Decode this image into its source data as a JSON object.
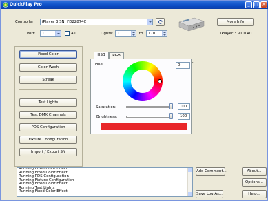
{
  "window": {
    "title": "QuickPlay Pro",
    "controls": {
      "minimize": "_",
      "maximize": "□",
      "close": "×"
    }
  },
  "header": {
    "controller_label": "Controller:",
    "controller_value": "iPlayer 3 SN: FD22874C",
    "port_label": "Port:",
    "port_value": "1",
    "all_label": "All",
    "all_checked": false,
    "lights_label": "Lights:",
    "lights_from": "1",
    "lights_to_label": "to",
    "lights_to": "170",
    "more_info_label": "More Info",
    "device_version": "iPlayer 3 v1.0.40"
  },
  "sidebar": {
    "items": [
      {
        "label": "Fixed Color",
        "active": true
      },
      {
        "label": "Color Wash",
        "active": false
      },
      {
        "label": "Streak",
        "active": false
      },
      {
        "label": "Test Lights",
        "active": false
      },
      {
        "label": "Test DMX Channels",
        "active": false
      },
      {
        "label": "PDS Configuration",
        "active": false
      },
      {
        "label": "Fixture Configuration",
        "active": false
      },
      {
        "label": "Import / Export SN",
        "active": false
      }
    ]
  },
  "color_panel": {
    "tabs": [
      {
        "label": "HSB",
        "active": true
      },
      {
        "label": "RGB",
        "active": false
      }
    ],
    "hue_label": "Hue:",
    "hue_value": "0",
    "hue_unit": "°",
    "saturation_label": "Saturation:",
    "saturation_value": "100",
    "saturation_level": 1.0,
    "brightness_label": "Brightness:",
    "brightness_value": "100",
    "brightness_level": 1.0,
    "preview_color": "#e8262a"
  },
  "log": {
    "lines": [
      "Running Fixed Color Effect",
      "Running Fixed Color Effect",
      "Running PDS Configuration",
      "Running Fixture Configuration",
      "Running Fixed Color Effect",
      "Running Test Lights",
      "Running Fixed Color Effect"
    ]
  },
  "actions": {
    "add_comment_label": "Add Comment...",
    "save_log_label": "Save Log As...",
    "about_label": "About...",
    "options_label": "Options...",
    "help_label": "Help..."
  }
}
